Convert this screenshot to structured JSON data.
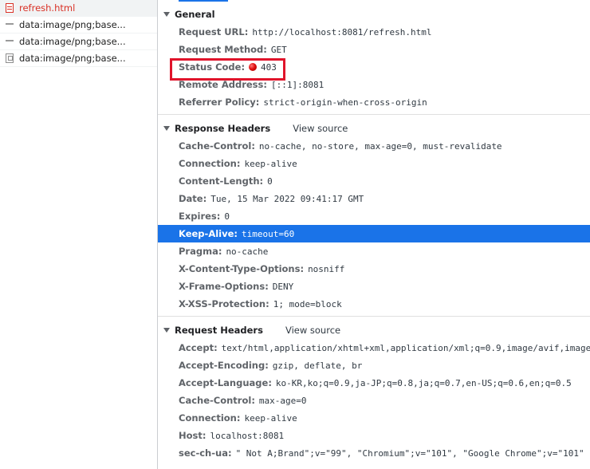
{
  "request_list": [
    {
      "name": "refresh.html",
      "icon": "document-icon",
      "selected": true
    },
    {
      "name": "data:image/png;base...",
      "icon": "dash-icon",
      "selected": false
    },
    {
      "name": "data:image/png;base...",
      "icon": "dash-icon",
      "selected": false
    },
    {
      "name": "data:image/png;base...",
      "icon": "image-icon",
      "selected": false
    }
  ],
  "general": {
    "title": "General",
    "request_url": {
      "k": "Request URL:",
      "v": "http://localhost:8081/refresh.html"
    },
    "request_method": {
      "k": "Request Method:",
      "v": "GET"
    },
    "status_code": {
      "k": "Status Code:",
      "v": "403"
    },
    "remote_address": {
      "k": "Remote Address:",
      "v": "[::1]:8081"
    },
    "referrer_policy": {
      "k": "Referrer Policy:",
      "v": "strict-origin-when-cross-origin"
    }
  },
  "response_headers": {
    "title": "Response Headers",
    "view_source": "View source",
    "rows": [
      {
        "k": "Cache-Control:",
        "v": "no-cache, no-store, max-age=0, must-revalidate"
      },
      {
        "k": "Connection:",
        "v": "keep-alive"
      },
      {
        "k": "Content-Length:",
        "v": "0"
      },
      {
        "k": "Date:",
        "v": "Tue, 15 Mar 2022 09:41:17 GMT"
      },
      {
        "k": "Expires:",
        "v": "0"
      },
      {
        "k": "Keep-Alive:",
        "v": "timeout=60"
      },
      {
        "k": "Pragma:",
        "v": "no-cache"
      },
      {
        "k": "X-Content-Type-Options:",
        "v": "nosniff"
      },
      {
        "k": "X-Frame-Options:",
        "v": "DENY"
      },
      {
        "k": "X-XSS-Protection:",
        "v": "1; mode=block"
      }
    ]
  },
  "request_headers": {
    "title": "Request Headers",
    "view_source": "View source",
    "rows": [
      {
        "k": "Accept:",
        "v": "text/html,application/xhtml+xml,application/xml;q=0.9,image/avif,image/"
      },
      {
        "k": "Accept-Encoding:",
        "v": "gzip, deflate, br"
      },
      {
        "k": "Accept-Language:",
        "v": "ko-KR,ko;q=0.9,ja-JP;q=0.8,ja;q=0.7,en-US;q=0.6,en;q=0.5"
      },
      {
        "k": "Cache-Control:",
        "v": "max-age=0"
      },
      {
        "k": "Connection:",
        "v": "keep-alive"
      },
      {
        "k": "Host:",
        "v": "localhost:8081"
      },
      {
        "k": "sec-ch-ua:",
        "v": "\" Not A;Brand\";v=\"99\", \"Chromium\";v=\"101\", \"Google Chrome\";v=\"101\""
      }
    ]
  },
  "colors": {
    "selection": "#1a73e8",
    "status_error": "#e01010",
    "annotation_box": "#e0142b"
  }
}
